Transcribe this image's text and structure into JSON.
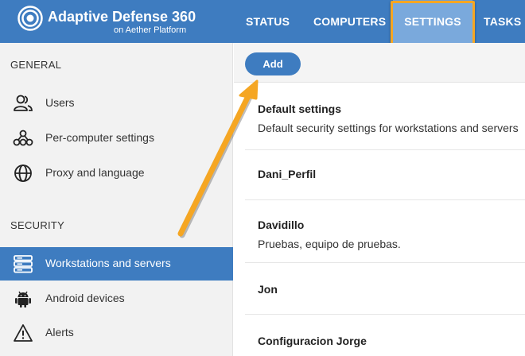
{
  "header": {
    "title": "Adaptive Defense 360",
    "subtitle": "on Aether Platform",
    "tabs": [
      {
        "label": "STATUS"
      },
      {
        "label": "COMPUTERS"
      },
      {
        "label": "SETTINGS"
      },
      {
        "label": "TASKS"
      }
    ],
    "active_tab": "SETTINGS"
  },
  "sidebar": {
    "sections": [
      {
        "label": "GENERAL"
      },
      {
        "label": "SECURITY"
      }
    ],
    "items": [
      {
        "label": "Users",
        "icon": "users-icon"
      },
      {
        "label": "Per-computer settings",
        "icon": "network-icon"
      },
      {
        "label": "Proxy and language",
        "icon": "globe-icon"
      },
      {
        "label": "Workstations and servers",
        "icon": "server-icon"
      },
      {
        "label": "Android devices",
        "icon": "android-icon"
      },
      {
        "label": "Alerts",
        "icon": "warning-icon"
      }
    ],
    "active_item": "Workstations and servers"
  },
  "toolbar": {
    "add_label": "Add"
  },
  "profiles": [
    {
      "name": "Default settings",
      "description": "Default security settings for workstations and servers"
    },
    {
      "name": "Dani_Perfil",
      "description": ""
    },
    {
      "name": "Davidillo",
      "description": "Pruebas, equipo de pruebas."
    },
    {
      "name": "Jon",
      "description": ""
    },
    {
      "name": "Configuracion Jorge",
      "description": ""
    }
  ],
  "colors": {
    "brand_blue": "#3e7cc0",
    "active_tab": "#7aa9dc",
    "annotation_orange": "#f5a623"
  }
}
